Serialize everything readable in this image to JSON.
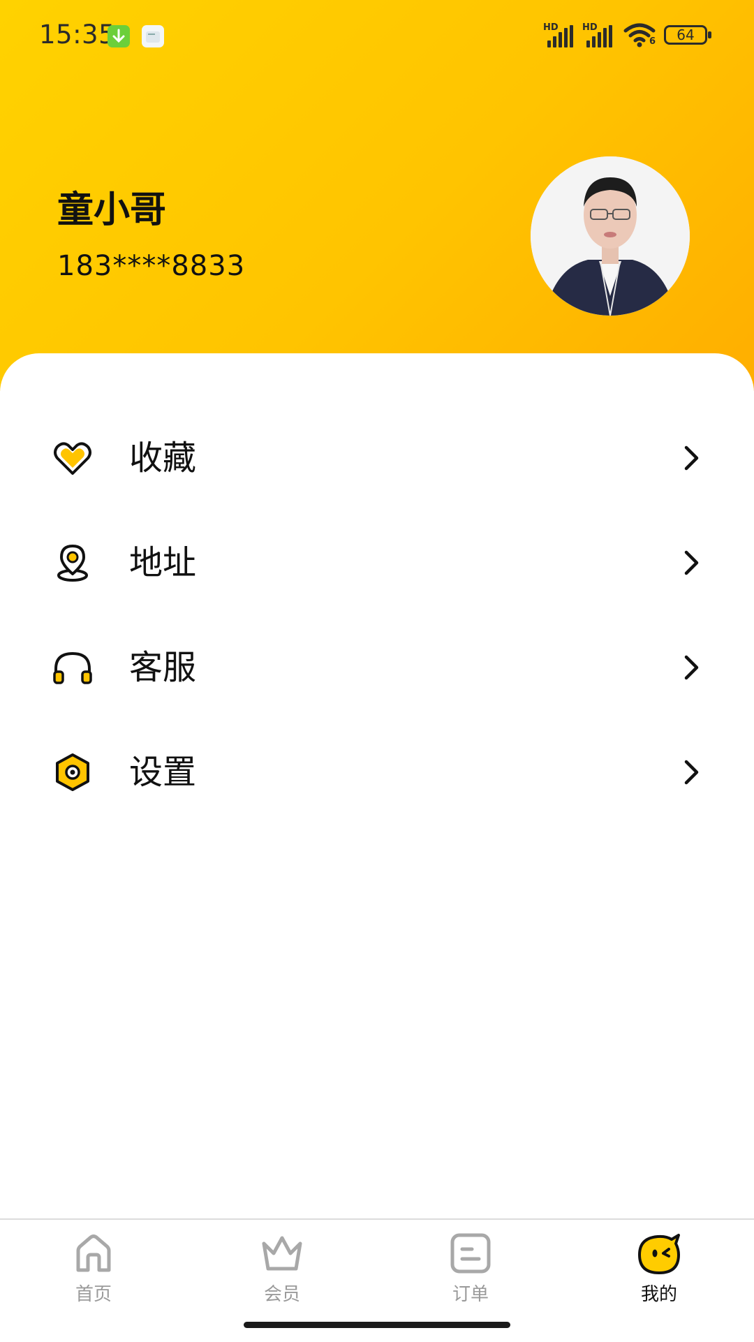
{
  "status_bar": {
    "time": "15:35",
    "signal_label_1": "HD",
    "signal_label_2": "HD",
    "wifi_label": "6",
    "battery": "64"
  },
  "profile": {
    "name": "童小哥",
    "phone": "183****8833"
  },
  "menu": [
    {
      "label": "收藏",
      "icon": "heart-icon"
    },
    {
      "label": "地址",
      "icon": "location-pin-icon"
    },
    {
      "label": "客服",
      "icon": "headphones-icon"
    },
    {
      "label": "设置",
      "icon": "settings-hexagon-icon"
    }
  ],
  "tabs": [
    {
      "label": "首页",
      "icon": "home-icon",
      "active": false
    },
    {
      "label": "会员",
      "icon": "crown-icon",
      "active": false
    },
    {
      "label": "订单",
      "icon": "order-icon",
      "active": false
    },
    {
      "label": "我的",
      "icon": "mine-face-icon",
      "active": true
    }
  ],
  "colors": {
    "accent": "#ffc400",
    "header_gradient_start": "#ffd200",
    "header_gradient_end": "#ffae00",
    "tab_inactive": "#9a9a9a",
    "tab_active": "#111111"
  }
}
